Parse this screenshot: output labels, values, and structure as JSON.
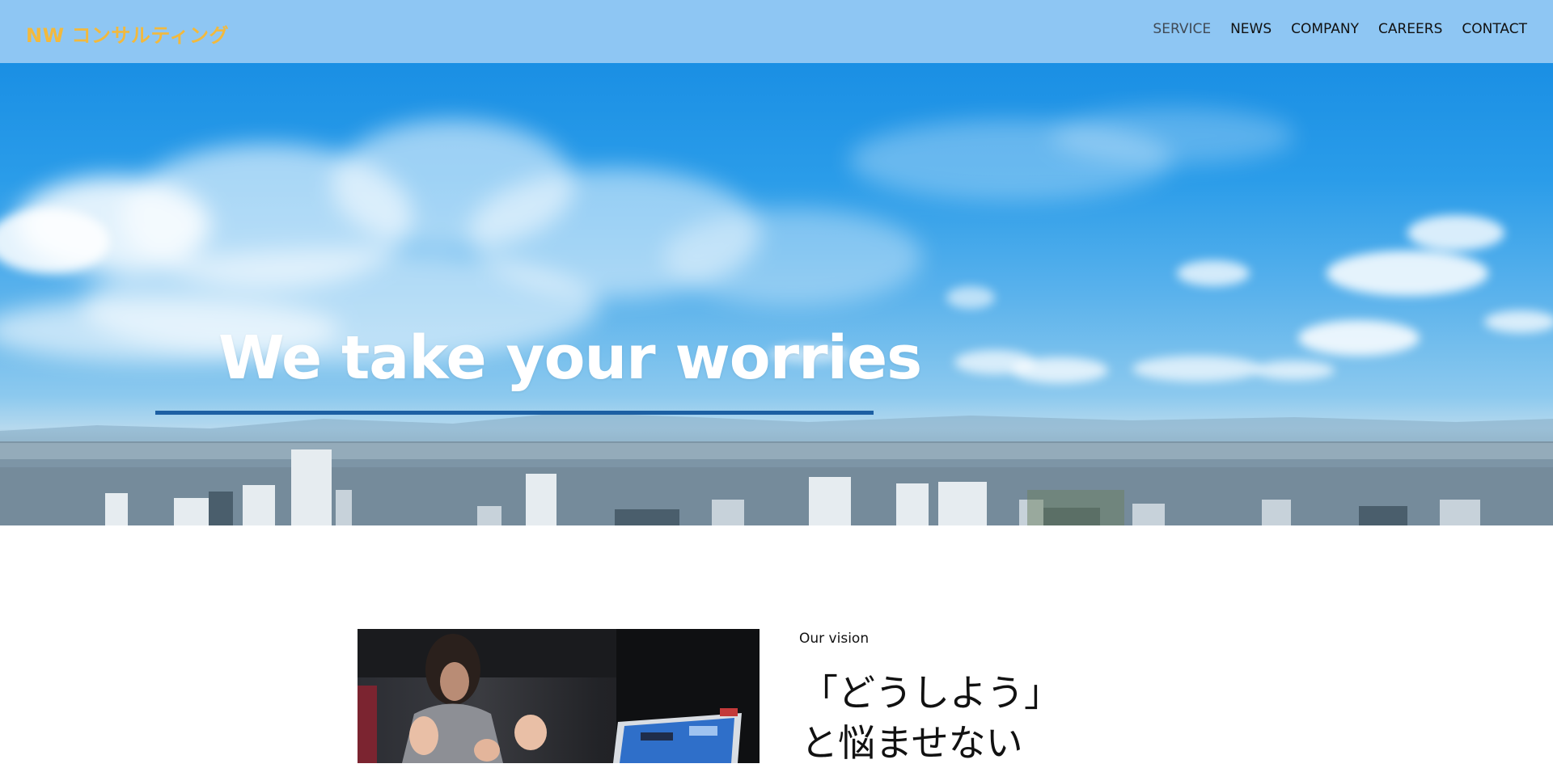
{
  "header": {
    "logo": "NW コンサルティング",
    "nav": [
      {
        "label": "SERVICE",
        "active": true
      },
      {
        "label": "NEWS",
        "active": false
      },
      {
        "label": "COMPANY",
        "active": false
      },
      {
        "label": "CAREERS",
        "active": false
      },
      {
        "label": "CONTACT",
        "active": false
      }
    ]
  },
  "hero": {
    "title": "We take your worries",
    "image": "city-skyline-with-clouds"
  },
  "vision": {
    "label": "Our vision",
    "heading_line1": "「どうしよう」",
    "heading_line2": "と悩ませない",
    "image": "meeting-with-laptop"
  },
  "colors": {
    "header_bg": "#8ec6f3",
    "logo": "#f2b93d",
    "hero_underline": "#1c5fa3"
  }
}
